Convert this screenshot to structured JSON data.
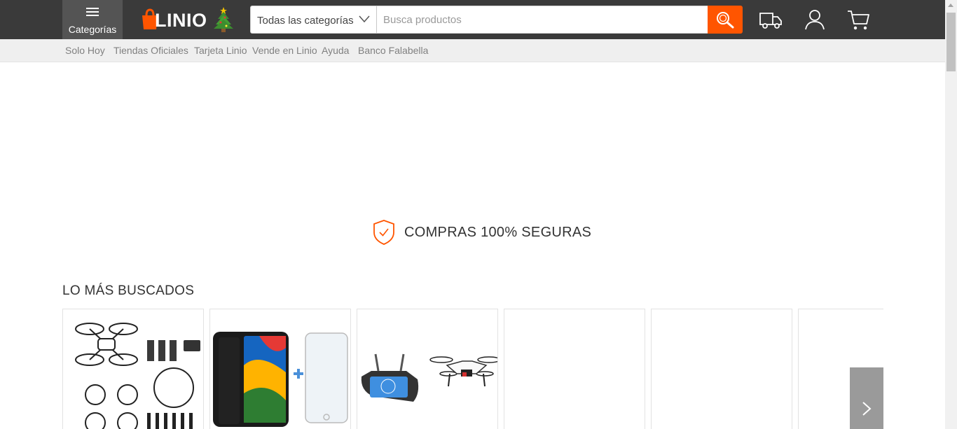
{
  "header": {
    "categories_label": "Categorías",
    "logo_text": "LINIO",
    "category_select": "Todas las categorías",
    "search_placeholder": "Busca productos",
    "accent_color": "#ff5500"
  },
  "subnav": {
    "items": [
      {
        "label": "Solo Hoy"
      },
      {
        "label": "Tiendas Oficiales"
      },
      {
        "label": "Tarjeta Linio"
      },
      {
        "label": "Vende en Linio"
      },
      {
        "label": "Ayuda"
      },
      {
        "label": "Banco Falabella"
      }
    ]
  },
  "secure_banner": {
    "text": "COMPRAS 100% SEGURAS",
    "icon": "shield-check-icon"
  },
  "most_searched": {
    "title": "LO MÁS BUSCADOS",
    "products": [
      {
        "image": "drone-kit-image"
      },
      {
        "image": "smartphone-with-screen-protector-image"
      },
      {
        "image": "drone-with-remote-image"
      },
      {
        "image": ""
      },
      {
        "image": ""
      },
      {
        "image": ""
      }
    ]
  },
  "icons": {
    "menu": "hamburger-icon",
    "search": "magnifier-icon",
    "delivery": "truck-icon",
    "account": "user-icon",
    "cart": "cart-icon",
    "next": "chevron-right-icon"
  }
}
